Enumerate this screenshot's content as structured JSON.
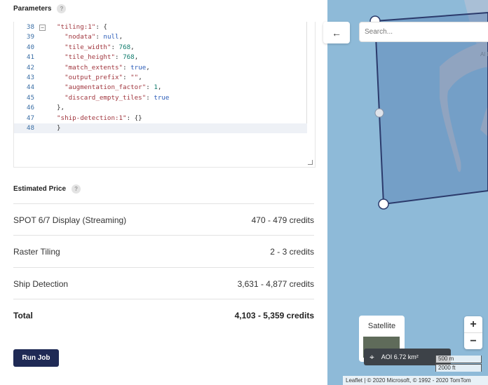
{
  "parameters": {
    "title": "Parameters",
    "help": "?"
  },
  "editor": {
    "lines": [
      {
        "n": "38",
        "tokens": [
          [
            "str",
            "\"tiling:1\""
          ],
          [
            "plain",
            ": {"
          ]
        ],
        "fold": "⊟"
      },
      {
        "n": "39",
        "tokens": [
          [
            "plain",
            "  "
          ],
          [
            "str",
            "\"nodata\""
          ],
          [
            "plain",
            ": "
          ],
          [
            "kw",
            "null"
          ],
          [
            "plain",
            ","
          ]
        ]
      },
      {
        "n": "40",
        "tokens": [
          [
            "plain",
            "  "
          ],
          [
            "str",
            "\"tile_width\""
          ],
          [
            "plain",
            ": "
          ],
          [
            "num",
            "768"
          ],
          [
            "plain",
            ","
          ]
        ]
      },
      {
        "n": "41",
        "tokens": [
          [
            "plain",
            "  "
          ],
          [
            "str",
            "\"tile_height\""
          ],
          [
            "plain",
            ": "
          ],
          [
            "num",
            "768"
          ],
          [
            "plain",
            ","
          ]
        ]
      },
      {
        "n": "42",
        "tokens": [
          [
            "plain",
            "  "
          ],
          [
            "str",
            "\"match_extents\""
          ],
          [
            "plain",
            ": "
          ],
          [
            "kw",
            "true"
          ],
          [
            "plain",
            ","
          ]
        ]
      },
      {
        "n": "43",
        "tokens": [
          [
            "plain",
            "  "
          ],
          [
            "str",
            "\"output_prefix\""
          ],
          [
            "plain",
            ": "
          ],
          [
            "str",
            "\"\""
          ],
          [
            "plain",
            ","
          ]
        ]
      },
      {
        "n": "44",
        "tokens": [
          [
            "plain",
            "  "
          ],
          [
            "str",
            "\"augmentation_factor\""
          ],
          [
            "plain",
            ": "
          ],
          [
            "num",
            "1"
          ],
          [
            "plain",
            ","
          ]
        ]
      },
      {
        "n": "45",
        "tokens": [
          [
            "plain",
            "  "
          ],
          [
            "str",
            "\"discard_empty_tiles\""
          ],
          [
            "plain",
            ": "
          ],
          [
            "kw",
            "true"
          ]
        ]
      },
      {
        "n": "46",
        "tokens": [
          [
            "plain",
            "},"
          ]
        ]
      },
      {
        "n": "47",
        "tokens": [
          [
            "str",
            "\"ship-detection:1\""
          ],
          [
            "plain",
            ": {}"
          ]
        ]
      },
      {
        "n": "48",
        "tokens": [
          [
            "plain",
            "}"
          ]
        ],
        "active": true
      }
    ]
  },
  "price": {
    "title": "Estimated Price",
    "help": "?",
    "rows": [
      {
        "label": "SPOT 6/7 Display (Streaming)",
        "value": "470 - 479 credits"
      },
      {
        "label": "Raster Tiling",
        "value": "2 - 3 credits"
      },
      {
        "label": "Ship Detection",
        "value": "3,631 - 4,877 credits"
      }
    ],
    "total": {
      "label": "Total",
      "value": "4,103 - 5,359 credits"
    }
  },
  "run_button": "Run Job",
  "map": {
    "back_icon": "arrow-left-icon",
    "search_placeholder": "Search...",
    "satellite_label": "Satellite",
    "zoom_in": "+",
    "zoom_out": "−",
    "aoi_label": "AOI 6.72 km²",
    "scale_metric": "500 m",
    "scale_imperial": "2000 ft",
    "attribution": "Leaflet | © 2020 Microsoft, © 1992 - 2020 TomTom",
    "corner_text": "Al De",
    "colors": {
      "water": "#8ebad8",
      "aoi_fill": "#6e92be",
      "aoi_stroke": "#2b3a6b",
      "land": "#b9c2cc"
    }
  },
  "colors": {
    "run_button": "#1f2a55"
  }
}
